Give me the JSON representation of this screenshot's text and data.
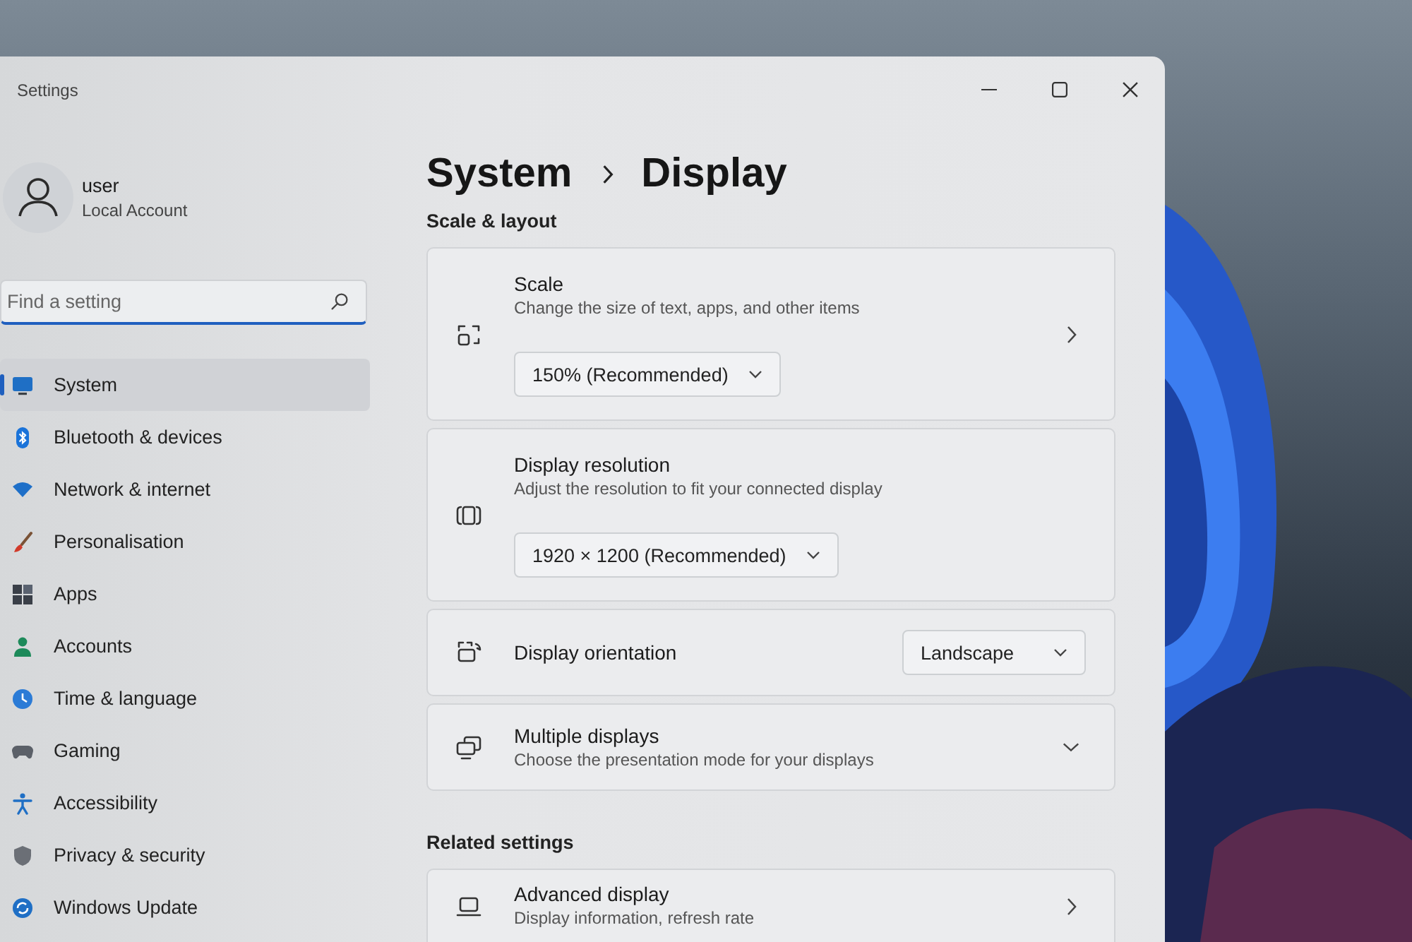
{
  "window": {
    "title": "Settings"
  },
  "account": {
    "name": "user",
    "type": "Local Account"
  },
  "search": {
    "placeholder": "Find a setting"
  },
  "sidebar": {
    "items": [
      {
        "label": "System",
        "selected": true
      },
      {
        "label": "Bluetooth & devices",
        "selected": false
      },
      {
        "label": "Network & internet",
        "selected": false
      },
      {
        "label": "Personalisation",
        "selected": false
      },
      {
        "label": "Apps",
        "selected": false
      },
      {
        "label": "Accounts",
        "selected": false
      },
      {
        "label": "Time & language",
        "selected": false
      },
      {
        "label": "Gaming",
        "selected": false
      },
      {
        "label": "Accessibility",
        "selected": false
      },
      {
        "label": "Privacy & security",
        "selected": false
      },
      {
        "label": "Windows Update",
        "selected": false
      }
    ]
  },
  "breadcrumb": {
    "parent": "System",
    "current": "Display"
  },
  "sections": [
    {
      "heading": "Scale & layout",
      "cards": [
        {
          "kind": "stacked",
          "title": "Scale",
          "description": "Change the size of text, apps, and other items",
          "dropdown": "150% (Recommended)",
          "navigable": true
        },
        {
          "kind": "stacked",
          "title": "Display resolution",
          "description": "Adjust the resolution to fit your connected display",
          "dropdown": "1920 × 1200 (Recommended)",
          "navigable": false
        },
        {
          "kind": "inline",
          "title": "Display orientation",
          "dropdown": "Landscape"
        },
        {
          "kind": "expander",
          "title": "Multiple displays",
          "description": "Choose the presentation mode for your displays",
          "expanded": false
        }
      ]
    },
    {
      "heading": "Related settings",
      "cards": [
        {
          "kind": "link",
          "title": "Advanced display",
          "description": "Display information, refresh rate"
        }
      ]
    }
  ]
}
